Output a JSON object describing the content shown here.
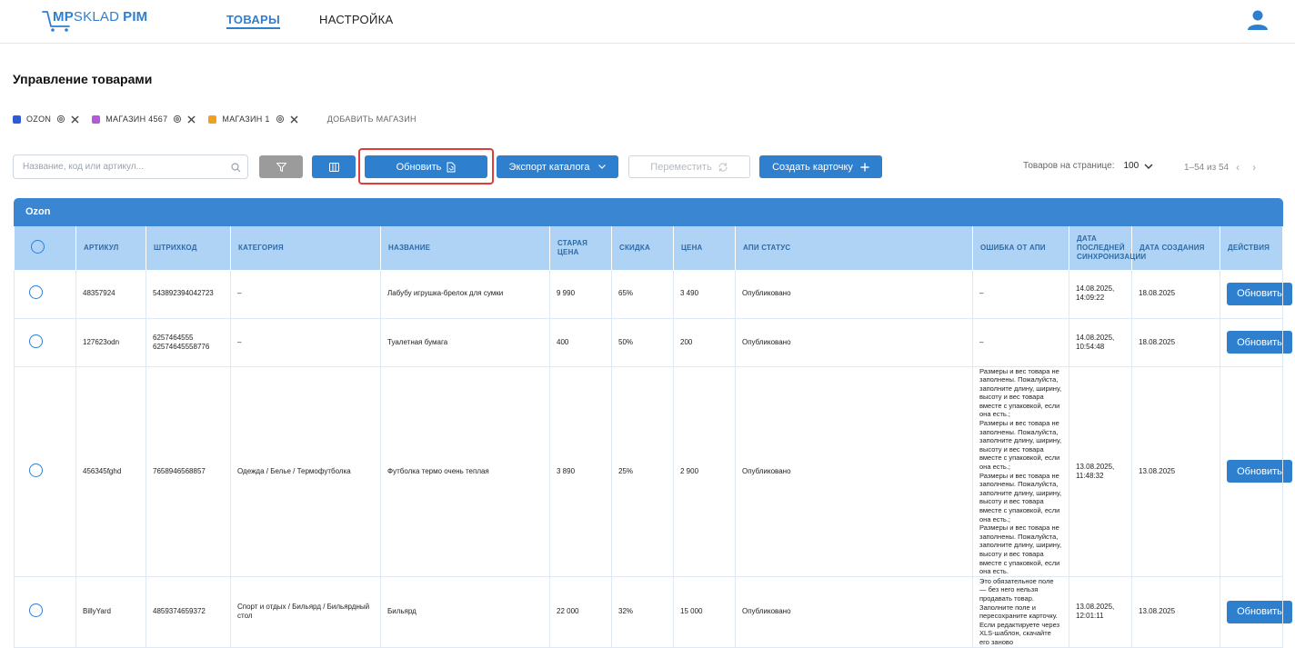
{
  "header": {
    "logo": {
      "mp": "MP",
      "sklad": "SKLAD",
      "pim": "PIM"
    },
    "nav": [
      {
        "label": "ТОВАРЫ",
        "active": true
      },
      {
        "label": "НАСТРОЙКА",
        "active": false
      }
    ]
  },
  "page": {
    "title": "Управление товарами"
  },
  "stores": [
    {
      "name": "OZON",
      "color": "#2f5bd4"
    },
    {
      "name": "МАГАЗИН 4567",
      "color": "#b25ad8"
    },
    {
      "name": "МАГАЗИН 1",
      "color": "#f0a020"
    }
  ],
  "add_store_label": "ДОБАВИТЬ МАГАЗИН",
  "toolbar": {
    "search_placeholder": "Название, код или артикул...",
    "refresh_label": "Обновить",
    "export_label": "Экспорт каталога",
    "move_label": "Переместить",
    "create_label": "Создать карточку",
    "per_page_label": "Товаров на странице:",
    "per_page_value": "100",
    "pagination": "1–54 из 54"
  },
  "table": {
    "group": "Ozon",
    "columns": [
      "АРТИКУЛ",
      "ШТРИХКОД",
      "КАТЕГОРИЯ",
      "НАЗВАНИЕ",
      "СТАРАЯ ЦЕНА",
      "СКИДКА",
      "ЦЕНА",
      "АПИ СТАТУС",
      "ОШИБКА ОТ АПИ",
      "ДАТА ПОСЛЕДНЕЙ СИНХРОНИЗАЦИИ",
      "ДАТА СОЗДАНИЯ",
      "ДЕЙСТВИЯ"
    ],
    "rows": [
      {
        "article": "48357924",
        "barcode": "543892394042723",
        "category": "–",
        "name": "Лабубу игрушка-брелок для сумки",
        "old_price": "9 990",
        "discount": "65%",
        "price": "3 490",
        "status": "Опубликовано",
        "error": "–",
        "synced": "14.08.2025, 14:09:22",
        "created": "18.08.2025",
        "action": "Обновить"
      },
      {
        "article": "127623odn",
        "barcode": "6257464555\n62574645558776",
        "category": "–",
        "name": "Туалетная бумага",
        "old_price": "400",
        "discount": "50%",
        "price": "200",
        "status": "Опубликовано",
        "error": "–",
        "synced": "14.08.2025, 10:54:48",
        "created": "18.08.2025",
        "action": "Обновить"
      },
      {
        "article": "456345fghd",
        "barcode": "7658946568857",
        "category": "Одежда / Белье / Термофутболка",
        "name": "Футболка термо очень теплая",
        "old_price": "3 890",
        "discount": "25%",
        "price": "2 900",
        "status": "Опубликовано",
        "error": "Размеры и вес товара не заполнены. Пожалуйста, заполните длину, ширину, высоту и вес товара вместе с упаковкой, если она есть.;\nРазмеры и вес товара не заполнены. Пожалуйста, заполните длину, ширину, высоту и вес товара вместе с упаковкой, если она есть.;\nРазмеры и вес товара не заполнены. Пожалуйста, заполните длину, ширину, высоту и вес товара вместе с упаковкой, если она есть.;\nРазмеры и вес товара не заполнены. Пожалуйста, заполните длину, ширину, высоту и вес товара вместе с упаковкой, если она есть.",
        "synced": "13.08.2025, 11:48:32",
        "created": "13.08.2025",
        "action": "Обновить"
      },
      {
        "article": "BillyYard",
        "barcode": "4859374659372",
        "category": "Спорт и отдых / Бильярд / Бильярдный стол",
        "name": "Бильярд",
        "old_price": "22 000",
        "discount": "32%",
        "price": "15 000",
        "status": "Опубликовано",
        "error": "Это обязательное поле — без него нельзя продавать товар. Заполните поле и пересохраните карточку. Если редактируете через XLS-шаблон, скачайте его заново",
        "synced": "13.08.2025, 12:01:11",
        "created": "13.08.2025",
        "action": "Обновить"
      }
    ]
  }
}
